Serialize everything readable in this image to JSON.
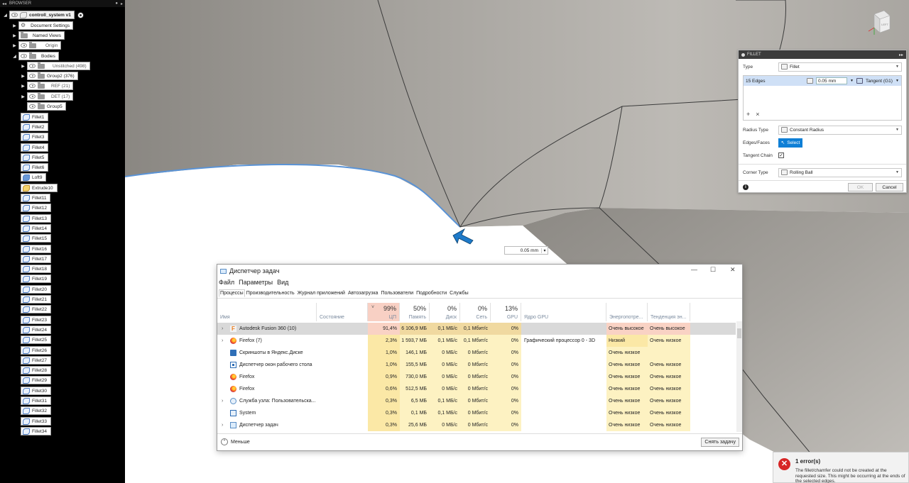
{
  "browser": {
    "header": "BROWSER",
    "root": "controll_system v1",
    "nodes": [
      {
        "label": "Document Settings",
        "icon": "gear"
      },
      {
        "label": "Named Views",
        "icon": "folder"
      },
      {
        "label": "Origin",
        "icon": "folder"
      },
      {
        "label": "Bodies",
        "icon": "folder"
      },
      {
        "label": "Unstitched (498)",
        "icon": "folder"
      },
      {
        "label": "Group2 (376)",
        "icon": "folder"
      },
      {
        "label": "REF (21)",
        "icon": "folder"
      },
      {
        "label": "DET (17)",
        "icon": "folder"
      },
      {
        "label": "Group5",
        "icon": "folder"
      }
    ],
    "features": [
      "Fillet1",
      "Fillet2",
      "Fillet3",
      "Fillet4",
      "Fillet5",
      "Fillet6",
      "Loft9",
      "Extrude10",
      "Fillet11",
      "Fillet12",
      "Fillet13",
      "Fillet14",
      "Fillet15",
      "Fillet16",
      "Fillet17",
      "Fillet18",
      "Fillet19",
      "Fillet20",
      "Fillet21",
      "Fillet22",
      "Fillet23",
      "Fillet24",
      "Fillet25",
      "Fillet26",
      "Fillet27",
      "Fillet28",
      "Fillet29",
      "Fillet30",
      "Fillet31",
      "Fillet32",
      "Fillet33",
      "Fillet34"
    ]
  },
  "viewport": {
    "viewcube_label": "LEFT",
    "dimension_value": "0.05 mm"
  },
  "fillet": {
    "title": "FILLET",
    "type_label": "Type",
    "type_value": "Fillet",
    "edges_label": "15 Edges",
    "edges_size": "0.05 mm",
    "edges_continuity": "Tangent (G1)",
    "radius_type_label": "Radius Type",
    "radius_type_value": "Constant Radius",
    "edges_faces_label": "Edges/Faces",
    "select_button": "Select",
    "tangent_chain_label": "Tangent Chain",
    "corner_type_label": "Corner Type",
    "corner_type_value": "Rolling Ball",
    "ok": "OK",
    "cancel": "Cancel"
  },
  "taskmgr": {
    "title": "Диспетчер задач",
    "menu": [
      "Файл",
      "Параметры",
      "Вид"
    ],
    "tabs": [
      "Процессы",
      "Производительность",
      "Журнал приложений",
      "Автозагрузка",
      "Пользователи",
      "Подробности",
      "Службы"
    ],
    "columns": {
      "name": "Имя",
      "status": "Состояние",
      "cpu_pct": "99%",
      "cpu": "ЦП",
      "mem_pct": "50%",
      "mem": "Память",
      "disk_pct": "0%",
      "disk": "Диск",
      "net_pct": "0%",
      "net": "Сеть",
      "gpu_pct": "13%",
      "gpu": "GPU",
      "gpu_engine": "Ядро GPU",
      "power": "Энергопотре...",
      "power_trend": "Тенденция эн..."
    },
    "rows": [
      {
        "name": "Autodesk Fusion 360 (10)",
        "cpu": "91,4%",
        "mem": "6 106,9 МБ",
        "disk": "0,1 МБ/с",
        "net": "0,1 Мбит/с",
        "gpu": "0%",
        "engine": "",
        "power": "Очень высокое",
        "trend": "Очень высокое"
      },
      {
        "name": "Firefox (7)",
        "cpu": "2,3%",
        "mem": "1 593,7 МБ",
        "disk": "0,1 МБ/с",
        "net": "0,1 Мбит/с",
        "gpu": "0%",
        "engine": "Графический процессор 0 - 3D",
        "power": "Низкий",
        "trend": "Очень низкое"
      },
      {
        "name": "Скриншоты в Яндекс.Диске",
        "cpu": "1,0%",
        "mem": "146,1 МБ",
        "disk": "0 МБ/с",
        "net": "0 Мбит/с",
        "gpu": "0%",
        "engine": "",
        "power": "Очень низкое",
        "trend": ""
      },
      {
        "name": "Диспетчер окон рабочего стола",
        "cpu": "1,0%",
        "mem": "155,5 МБ",
        "disk": "0 МБ/с",
        "net": "0 Мбит/с",
        "gpu": "0%",
        "engine": "",
        "power": "Очень низкое",
        "trend": "Очень низкое"
      },
      {
        "name": "Firefox",
        "cpu": "0,9%",
        "mem": "730,0 МБ",
        "disk": "0 МБ/с",
        "net": "0 Мбит/с",
        "gpu": "0%",
        "engine": "",
        "power": "Очень низкое",
        "trend": "Очень низкое"
      },
      {
        "name": "Firefox",
        "cpu": "0,6%",
        "mem": "512,5 МБ",
        "disk": "0 МБ/с",
        "net": "0 Мбит/с",
        "gpu": "0%",
        "engine": "",
        "power": "Очень низкое",
        "trend": "Очень низкое"
      },
      {
        "name": "Служба узла: Пользовательска...",
        "cpu": "0,3%",
        "mem": "6,5 МБ",
        "disk": "0,1 МБ/с",
        "net": "0 Мбит/с",
        "gpu": "0%",
        "engine": "",
        "power": "Очень низкое",
        "trend": "Очень низкое"
      },
      {
        "name": "System",
        "cpu": "0,3%",
        "mem": "0,1 МБ",
        "disk": "0,1 МБ/с",
        "net": "0 Мбит/с",
        "gpu": "0%",
        "engine": "",
        "power": "Очень низкое",
        "trend": "Очень низкое"
      },
      {
        "name": "Диспетчер задач",
        "cpu": "0,3%",
        "mem": "25,6 МБ",
        "disk": "0 МБ/с",
        "net": "0 Мбит/с",
        "gpu": "0%",
        "engine": "",
        "power": "Очень низкое",
        "trend": "Очень низкое"
      }
    ],
    "less_label": "Меньше",
    "end_task": "Снять задачу"
  },
  "error": {
    "title": "1 error(s)",
    "message": "The fillet/chamfer could not be created at the requested size. This might be occurring at the ends of the selected edges."
  }
}
